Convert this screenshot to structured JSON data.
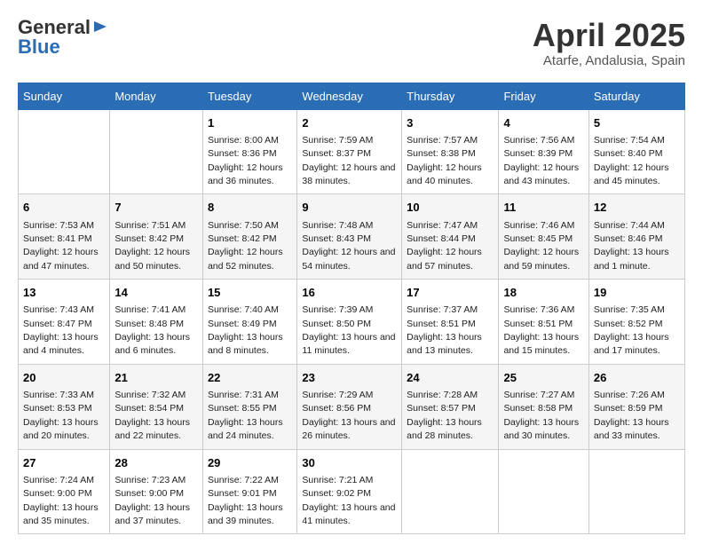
{
  "app": {
    "name_general": "General",
    "name_blue": "Blue"
  },
  "title": "April 2025",
  "subtitle": "Atarfe, Andalusia, Spain",
  "days_of_week": [
    "Sunday",
    "Monday",
    "Tuesday",
    "Wednesday",
    "Thursday",
    "Friday",
    "Saturday"
  ],
  "weeks": [
    [
      {
        "day": null
      },
      {
        "day": null
      },
      {
        "day": 1,
        "sunrise": "Sunrise: 8:00 AM",
        "sunset": "Sunset: 8:36 PM",
        "daylight": "Daylight: 12 hours and 36 minutes."
      },
      {
        "day": 2,
        "sunrise": "Sunrise: 7:59 AM",
        "sunset": "Sunset: 8:37 PM",
        "daylight": "Daylight: 12 hours and 38 minutes."
      },
      {
        "day": 3,
        "sunrise": "Sunrise: 7:57 AM",
        "sunset": "Sunset: 8:38 PM",
        "daylight": "Daylight: 12 hours and 40 minutes."
      },
      {
        "day": 4,
        "sunrise": "Sunrise: 7:56 AM",
        "sunset": "Sunset: 8:39 PM",
        "daylight": "Daylight: 12 hours and 43 minutes."
      },
      {
        "day": 5,
        "sunrise": "Sunrise: 7:54 AM",
        "sunset": "Sunset: 8:40 PM",
        "daylight": "Daylight: 12 hours and 45 minutes."
      }
    ],
    [
      {
        "day": 6,
        "sunrise": "Sunrise: 7:53 AM",
        "sunset": "Sunset: 8:41 PM",
        "daylight": "Daylight: 12 hours and 47 minutes."
      },
      {
        "day": 7,
        "sunrise": "Sunrise: 7:51 AM",
        "sunset": "Sunset: 8:42 PM",
        "daylight": "Daylight: 12 hours and 50 minutes."
      },
      {
        "day": 8,
        "sunrise": "Sunrise: 7:50 AM",
        "sunset": "Sunset: 8:42 PM",
        "daylight": "Daylight: 12 hours and 52 minutes."
      },
      {
        "day": 9,
        "sunrise": "Sunrise: 7:48 AM",
        "sunset": "Sunset: 8:43 PM",
        "daylight": "Daylight: 12 hours and 54 minutes."
      },
      {
        "day": 10,
        "sunrise": "Sunrise: 7:47 AM",
        "sunset": "Sunset: 8:44 PM",
        "daylight": "Daylight: 12 hours and 57 minutes."
      },
      {
        "day": 11,
        "sunrise": "Sunrise: 7:46 AM",
        "sunset": "Sunset: 8:45 PM",
        "daylight": "Daylight: 12 hours and 59 minutes."
      },
      {
        "day": 12,
        "sunrise": "Sunrise: 7:44 AM",
        "sunset": "Sunset: 8:46 PM",
        "daylight": "Daylight: 13 hours and 1 minute."
      }
    ],
    [
      {
        "day": 13,
        "sunrise": "Sunrise: 7:43 AM",
        "sunset": "Sunset: 8:47 PM",
        "daylight": "Daylight: 13 hours and 4 minutes."
      },
      {
        "day": 14,
        "sunrise": "Sunrise: 7:41 AM",
        "sunset": "Sunset: 8:48 PM",
        "daylight": "Daylight: 13 hours and 6 minutes."
      },
      {
        "day": 15,
        "sunrise": "Sunrise: 7:40 AM",
        "sunset": "Sunset: 8:49 PM",
        "daylight": "Daylight: 13 hours and 8 minutes."
      },
      {
        "day": 16,
        "sunrise": "Sunrise: 7:39 AM",
        "sunset": "Sunset: 8:50 PM",
        "daylight": "Daylight: 13 hours and 11 minutes."
      },
      {
        "day": 17,
        "sunrise": "Sunrise: 7:37 AM",
        "sunset": "Sunset: 8:51 PM",
        "daylight": "Daylight: 13 hours and 13 minutes."
      },
      {
        "day": 18,
        "sunrise": "Sunrise: 7:36 AM",
        "sunset": "Sunset: 8:51 PM",
        "daylight": "Daylight: 13 hours and 15 minutes."
      },
      {
        "day": 19,
        "sunrise": "Sunrise: 7:35 AM",
        "sunset": "Sunset: 8:52 PM",
        "daylight": "Daylight: 13 hours and 17 minutes."
      }
    ],
    [
      {
        "day": 20,
        "sunrise": "Sunrise: 7:33 AM",
        "sunset": "Sunset: 8:53 PM",
        "daylight": "Daylight: 13 hours and 20 minutes."
      },
      {
        "day": 21,
        "sunrise": "Sunrise: 7:32 AM",
        "sunset": "Sunset: 8:54 PM",
        "daylight": "Daylight: 13 hours and 22 minutes."
      },
      {
        "day": 22,
        "sunrise": "Sunrise: 7:31 AM",
        "sunset": "Sunset: 8:55 PM",
        "daylight": "Daylight: 13 hours and 24 minutes."
      },
      {
        "day": 23,
        "sunrise": "Sunrise: 7:29 AM",
        "sunset": "Sunset: 8:56 PM",
        "daylight": "Daylight: 13 hours and 26 minutes."
      },
      {
        "day": 24,
        "sunrise": "Sunrise: 7:28 AM",
        "sunset": "Sunset: 8:57 PM",
        "daylight": "Daylight: 13 hours and 28 minutes."
      },
      {
        "day": 25,
        "sunrise": "Sunrise: 7:27 AM",
        "sunset": "Sunset: 8:58 PM",
        "daylight": "Daylight: 13 hours and 30 minutes."
      },
      {
        "day": 26,
        "sunrise": "Sunrise: 7:26 AM",
        "sunset": "Sunset: 8:59 PM",
        "daylight": "Daylight: 13 hours and 33 minutes."
      }
    ],
    [
      {
        "day": 27,
        "sunrise": "Sunrise: 7:24 AM",
        "sunset": "Sunset: 9:00 PM",
        "daylight": "Daylight: 13 hours and 35 minutes."
      },
      {
        "day": 28,
        "sunrise": "Sunrise: 7:23 AM",
        "sunset": "Sunset: 9:00 PM",
        "daylight": "Daylight: 13 hours and 37 minutes."
      },
      {
        "day": 29,
        "sunrise": "Sunrise: 7:22 AM",
        "sunset": "Sunset: 9:01 PM",
        "daylight": "Daylight: 13 hours and 39 minutes."
      },
      {
        "day": 30,
        "sunrise": "Sunrise: 7:21 AM",
        "sunset": "Sunset: 9:02 PM",
        "daylight": "Daylight: 13 hours and 41 minutes."
      },
      {
        "day": null
      },
      {
        "day": null
      },
      {
        "day": null
      }
    ]
  ]
}
